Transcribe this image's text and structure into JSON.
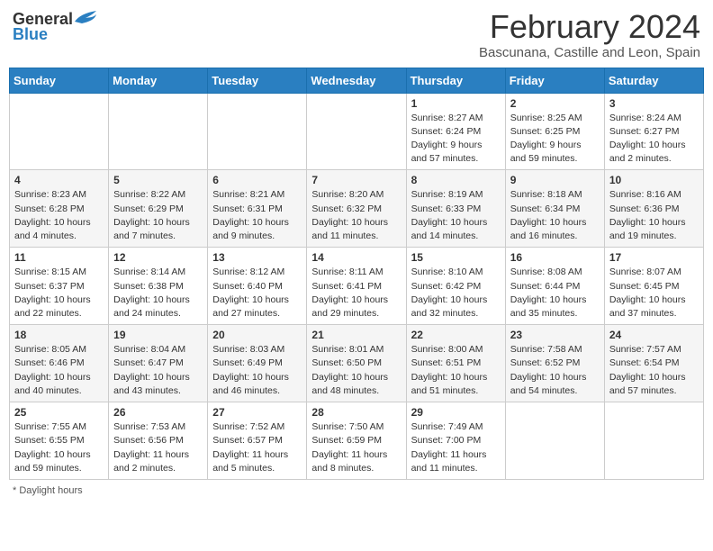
{
  "header": {
    "logo_general": "General",
    "logo_blue": "Blue",
    "month_year": "February 2024",
    "location": "Bascunana, Castille and Leon, Spain"
  },
  "days_of_week": [
    "Sunday",
    "Monday",
    "Tuesday",
    "Wednesday",
    "Thursday",
    "Friday",
    "Saturday"
  ],
  "footer": {
    "daylight_label": "Daylight hours"
  },
  "weeks": [
    [
      {
        "day": "",
        "info": ""
      },
      {
        "day": "",
        "info": ""
      },
      {
        "day": "",
        "info": ""
      },
      {
        "day": "",
        "info": ""
      },
      {
        "day": "1",
        "info": "Sunrise: 8:27 AM\nSunset: 6:24 PM\nDaylight: 9 hours\nand 57 minutes."
      },
      {
        "day": "2",
        "info": "Sunrise: 8:25 AM\nSunset: 6:25 PM\nDaylight: 9 hours\nand 59 minutes."
      },
      {
        "day": "3",
        "info": "Sunrise: 8:24 AM\nSunset: 6:27 PM\nDaylight: 10 hours\nand 2 minutes."
      }
    ],
    [
      {
        "day": "4",
        "info": "Sunrise: 8:23 AM\nSunset: 6:28 PM\nDaylight: 10 hours\nand 4 minutes."
      },
      {
        "day": "5",
        "info": "Sunrise: 8:22 AM\nSunset: 6:29 PM\nDaylight: 10 hours\nand 7 minutes."
      },
      {
        "day": "6",
        "info": "Sunrise: 8:21 AM\nSunset: 6:31 PM\nDaylight: 10 hours\nand 9 minutes."
      },
      {
        "day": "7",
        "info": "Sunrise: 8:20 AM\nSunset: 6:32 PM\nDaylight: 10 hours\nand 11 minutes."
      },
      {
        "day": "8",
        "info": "Sunrise: 8:19 AM\nSunset: 6:33 PM\nDaylight: 10 hours\nand 14 minutes."
      },
      {
        "day": "9",
        "info": "Sunrise: 8:18 AM\nSunset: 6:34 PM\nDaylight: 10 hours\nand 16 minutes."
      },
      {
        "day": "10",
        "info": "Sunrise: 8:16 AM\nSunset: 6:36 PM\nDaylight: 10 hours\nand 19 minutes."
      }
    ],
    [
      {
        "day": "11",
        "info": "Sunrise: 8:15 AM\nSunset: 6:37 PM\nDaylight: 10 hours\nand 22 minutes."
      },
      {
        "day": "12",
        "info": "Sunrise: 8:14 AM\nSunset: 6:38 PM\nDaylight: 10 hours\nand 24 minutes."
      },
      {
        "day": "13",
        "info": "Sunrise: 8:12 AM\nSunset: 6:40 PM\nDaylight: 10 hours\nand 27 minutes."
      },
      {
        "day": "14",
        "info": "Sunrise: 8:11 AM\nSunset: 6:41 PM\nDaylight: 10 hours\nand 29 minutes."
      },
      {
        "day": "15",
        "info": "Sunrise: 8:10 AM\nSunset: 6:42 PM\nDaylight: 10 hours\nand 32 minutes."
      },
      {
        "day": "16",
        "info": "Sunrise: 8:08 AM\nSunset: 6:44 PM\nDaylight: 10 hours\nand 35 minutes."
      },
      {
        "day": "17",
        "info": "Sunrise: 8:07 AM\nSunset: 6:45 PM\nDaylight: 10 hours\nand 37 minutes."
      }
    ],
    [
      {
        "day": "18",
        "info": "Sunrise: 8:05 AM\nSunset: 6:46 PM\nDaylight: 10 hours\nand 40 minutes."
      },
      {
        "day": "19",
        "info": "Sunrise: 8:04 AM\nSunset: 6:47 PM\nDaylight: 10 hours\nand 43 minutes."
      },
      {
        "day": "20",
        "info": "Sunrise: 8:03 AM\nSunset: 6:49 PM\nDaylight: 10 hours\nand 46 minutes."
      },
      {
        "day": "21",
        "info": "Sunrise: 8:01 AM\nSunset: 6:50 PM\nDaylight: 10 hours\nand 48 minutes."
      },
      {
        "day": "22",
        "info": "Sunrise: 8:00 AM\nSunset: 6:51 PM\nDaylight: 10 hours\nand 51 minutes."
      },
      {
        "day": "23",
        "info": "Sunrise: 7:58 AM\nSunset: 6:52 PM\nDaylight: 10 hours\nand 54 minutes."
      },
      {
        "day": "24",
        "info": "Sunrise: 7:57 AM\nSunset: 6:54 PM\nDaylight: 10 hours\nand 57 minutes."
      }
    ],
    [
      {
        "day": "25",
        "info": "Sunrise: 7:55 AM\nSunset: 6:55 PM\nDaylight: 10 hours\nand 59 minutes."
      },
      {
        "day": "26",
        "info": "Sunrise: 7:53 AM\nSunset: 6:56 PM\nDaylight: 11 hours\nand 2 minutes."
      },
      {
        "day": "27",
        "info": "Sunrise: 7:52 AM\nSunset: 6:57 PM\nDaylight: 11 hours\nand 5 minutes."
      },
      {
        "day": "28",
        "info": "Sunrise: 7:50 AM\nSunset: 6:59 PM\nDaylight: 11 hours\nand 8 minutes."
      },
      {
        "day": "29",
        "info": "Sunrise: 7:49 AM\nSunset: 7:00 PM\nDaylight: 11 hours\nand 11 minutes."
      },
      {
        "day": "",
        "info": ""
      },
      {
        "day": "",
        "info": ""
      }
    ]
  ]
}
